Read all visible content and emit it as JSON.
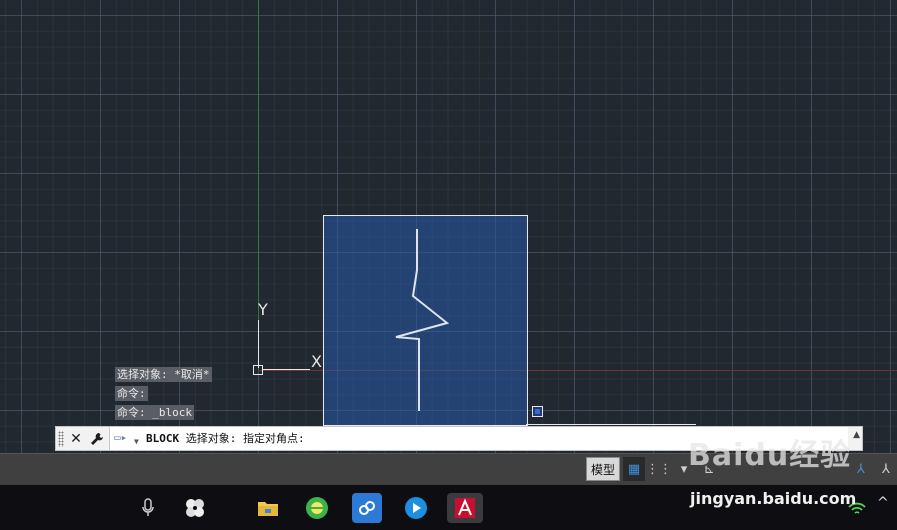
{
  "canvas": {
    "ucs": {
      "y_label": "Y",
      "x_label": "X"
    },
    "history": [
      "选择对象: *取消*",
      "命令:",
      "命令: _block"
    ]
  },
  "command_line": {
    "close_icon": "close-icon",
    "settings_icon": "wrench-icon",
    "command_name": "BLOCK",
    "prompt": "选择对象: 指定对角点:"
  },
  "status_bar": {
    "model_tab": "模型",
    "icons": [
      "grid-icon",
      "snap-icon",
      "chevron-down-icon",
      "ortho-icon",
      "selection-icon",
      "annotate-icon"
    ]
  },
  "taskbar": {
    "icons": [
      "microphone-icon",
      "pinwheel-icon",
      "file-explorer-icon",
      "browser-icon",
      "cloud-app-icon",
      "media-player-icon",
      "autocad-icon"
    ]
  },
  "watermark": {
    "logo_text": "Baidu经验",
    "url": "jingyan.baidu.com"
  },
  "colors": {
    "canvas_bg": "#212830",
    "selection_fill": "#285aaa",
    "accent": "#3d8fe0"
  }
}
